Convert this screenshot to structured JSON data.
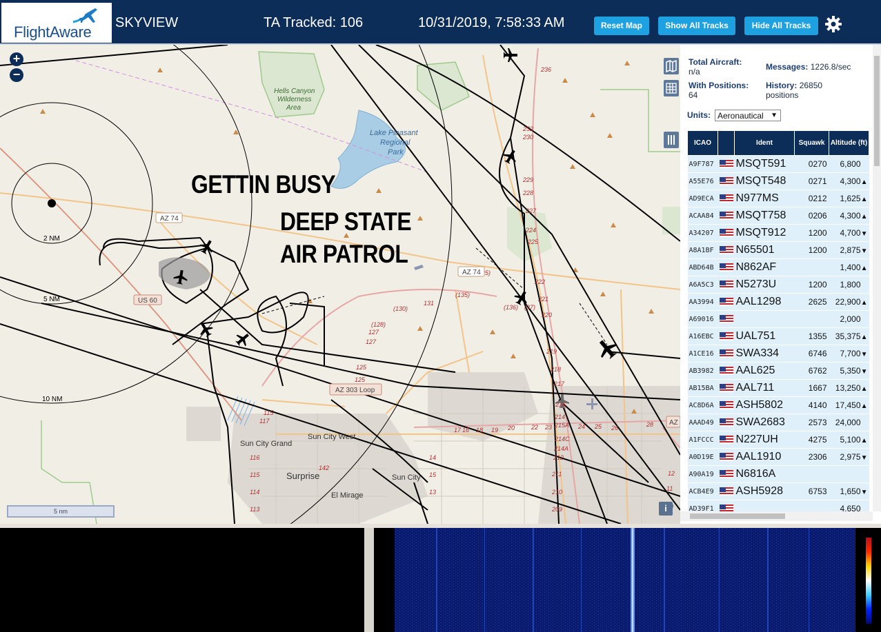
{
  "header": {
    "logo_text": "FlightAware",
    "app_name": "SKYVIEW",
    "tracked": "TA Tracked: 106",
    "datetime": "10/31/2019, 7:58:33 AM",
    "buttons": {
      "reset": "Reset Map",
      "show": "Show All Tracks",
      "hide": "Hide All Tracks"
    },
    "colors": {
      "bar": "#0d2d59",
      "button": "#1ea1e1"
    }
  },
  "map": {
    "zoom_in": "+",
    "zoom_out": "−",
    "scale": "5 nm",
    "overlay": [
      "GETTIN BUSY",
      "DEEP STATE",
      "AIR PATROL"
    ],
    "range_rings": [
      "2 NM",
      "5 NM",
      "10 NM"
    ],
    "places": [
      "Hells Canyon Wilderness Area",
      "Lake Pleasant Regional Park",
      "Sun City West",
      "Sun City Grand",
      "Sun City",
      "Surprise",
      "El Mirage"
    ],
    "shields": [
      "AZ 74",
      "AZ 74",
      "US 60",
      "AZ 303 Loop"
    ],
    "info_button": "i"
  },
  "panel": {
    "total_aircraft_label": "Total Aircraft:",
    "total_aircraft_value": "n/a",
    "with_positions_label": "With Positions:",
    "with_positions_value": "64",
    "messages_label": "Messages:",
    "messages_value": "1226.8/sec",
    "history_label": "History:",
    "history_value": "26850",
    "history_unit": "positions",
    "units_label": "Units:",
    "units_value": "Aeronautical",
    "columns": [
      "ICAO",
      "",
      "Ident",
      "Squawk",
      "Altitude (ft)"
    ],
    "rows": [
      {
        "icao": "A9F787",
        "ident": "MSQT591",
        "squawk": "0270",
        "alt": "6,800",
        "trend": ""
      },
      {
        "icao": "A55E76",
        "ident": "MSQT548",
        "squawk": "0271",
        "alt": "4,300",
        "trend": "▲"
      },
      {
        "icao": "AD9ECA",
        "ident": "N977MS",
        "squawk": "0212",
        "alt": "1,625",
        "trend": "▲"
      },
      {
        "icao": "ACAA84",
        "ident": "MSQT758",
        "squawk": "0206",
        "alt": "4,300",
        "trend": "▲"
      },
      {
        "icao": "A34207",
        "ident": "MSQT912",
        "squawk": "1200",
        "alt": "4,700",
        "trend": "▼"
      },
      {
        "icao": "A8A1BF",
        "ident": "N65501",
        "squawk": "1200",
        "alt": "2,875",
        "trend": "▼"
      },
      {
        "icao": "ABD64B",
        "ident": "N862AF",
        "squawk": "",
        "alt": "1,400",
        "trend": "▲"
      },
      {
        "icao": "A6A5C3",
        "ident": "N5273U",
        "squawk": "1200",
        "alt": "1,800",
        "trend": ""
      },
      {
        "icao": "AA3994",
        "ident": "AAL1298",
        "squawk": "2625",
        "alt": "22,900",
        "trend": "▲"
      },
      {
        "icao": "A69016",
        "ident": "",
        "squawk": "",
        "alt": "2,000",
        "trend": ""
      },
      {
        "icao": "A16EBC",
        "ident": "UAL751",
        "squawk": "1355",
        "alt": "35,375",
        "trend": "▲"
      },
      {
        "icao": "A1CE16",
        "ident": "SWA334",
        "squawk": "6746",
        "alt": "7,700",
        "trend": "▼"
      },
      {
        "icao": "AB3982",
        "ident": "AAL625",
        "squawk": "6762",
        "alt": "5,350",
        "trend": "▼"
      },
      {
        "icao": "AB15BA",
        "ident": "AAL711",
        "squawk": "1667",
        "alt": "13,250",
        "trend": "▲"
      },
      {
        "icao": "AC8D6A",
        "ident": "ASH5802",
        "squawk": "4140",
        "alt": "17,450",
        "trend": "▲"
      },
      {
        "icao": "AAAD49",
        "ident": "SWA2683",
        "squawk": "2573",
        "alt": "24,000",
        "trend": ""
      },
      {
        "icao": "A1FCCC",
        "ident": "N227UH",
        "squawk": "4275",
        "alt": "5,100",
        "trend": "▲"
      },
      {
        "icao": "A0D19E",
        "ident": "AAL1910",
        "squawk": "2306",
        "alt": "2,975",
        "trend": "▼"
      },
      {
        "icao": "A90A19",
        "ident": "N6816A",
        "squawk": "",
        "alt": "",
        "trend": ""
      },
      {
        "icao": "ACB4E9",
        "ident": "ASH5928",
        "squawk": "6753",
        "alt": "1,650",
        "trend": "▼"
      },
      {
        "icao": "AD39F1",
        "ident": "",
        "squawk": "",
        "alt": "4,650",
        "trend": ""
      }
    ]
  }
}
